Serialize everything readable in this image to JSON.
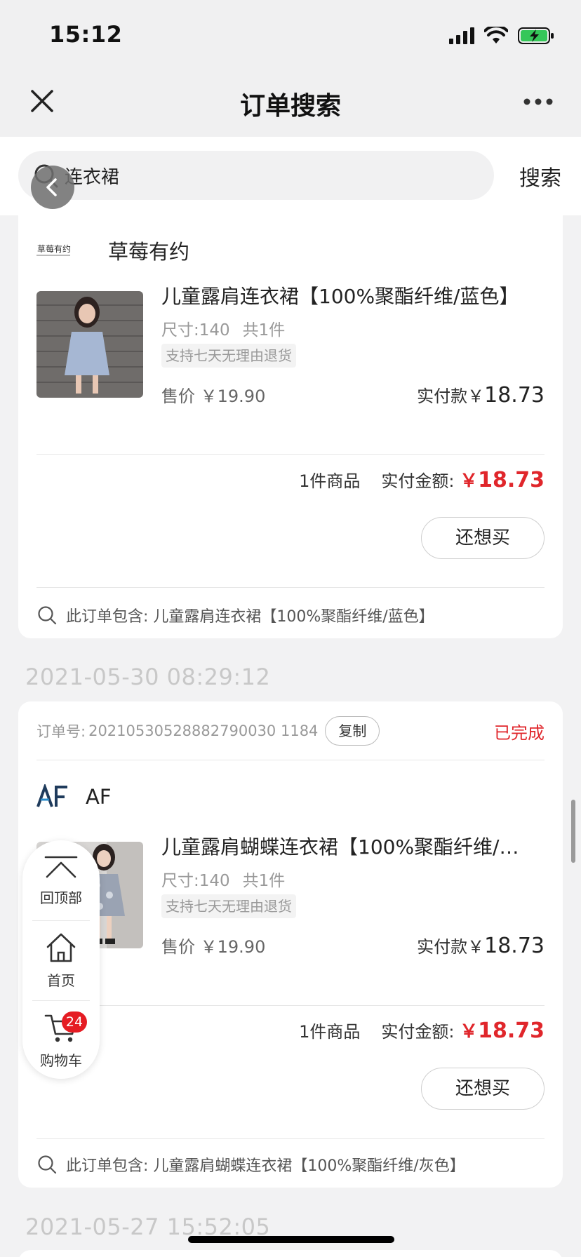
{
  "status_bar": {
    "time": "15:12"
  },
  "nav": {
    "title": "订单搜索"
  },
  "search": {
    "query": "连衣裙",
    "placeholder": "连衣裙",
    "submit_label": "搜索"
  },
  "orders": [
    {
      "shop_logo_text": "草莓有约",
      "shop_name": "草莓有约",
      "product": {
        "title": "儿童露肩连衣裙【100%聚酯纤维/蓝色】",
        "size": "尺寸:140",
        "qty": "共1件",
        "tag": "支持七天无理由退货",
        "price": "售价 ￥19.90",
        "paid_label": "实付款￥",
        "paid_amount": "18.73"
      },
      "summary": {
        "count": "1件商品",
        "label": "实付金额:",
        "currency": "￥",
        "amount": "18.73"
      },
      "rebuy_label": "还想买",
      "contains_text": "此订单包含: 儿童露肩连衣裙【100%聚酯纤维/蓝色】"
    },
    {
      "date": "2021-05-30 08:29:12",
      "order_no_label": "订单号:",
      "order_no": "20210530528882790030 1184",
      "copy_label": "复制",
      "status": "已完成",
      "shop_logo_text": "AF",
      "shop_name": "AF",
      "product": {
        "title": "儿童露肩蝴蝶连衣裙【100%聚酯纤维/…",
        "size": "尺寸:140",
        "qty": "共1件",
        "tag": "支持七天无理由退货",
        "price": "售价 ￥19.90",
        "paid_label": "实付款￥",
        "paid_amount": "18.73"
      },
      "summary": {
        "count": "1件商品",
        "label": "实付金额:",
        "currency": "￥",
        "amount": "18.73"
      },
      "rebuy_label": "还想买",
      "contains_text": "此订单包含: 儿童露肩蝴蝶连衣裙【100%聚酯纤维/灰色】"
    }
  ],
  "next_date": "2021-05-27 15:52:05",
  "float_nav": {
    "top_label": "回顶部",
    "home_label": "首页",
    "cart_label": "购物车",
    "cart_badge": "24"
  },
  "colors": {
    "price_red": "#e0262b",
    "badge_red": "#e51c23",
    "background": "#f2f2f3"
  }
}
